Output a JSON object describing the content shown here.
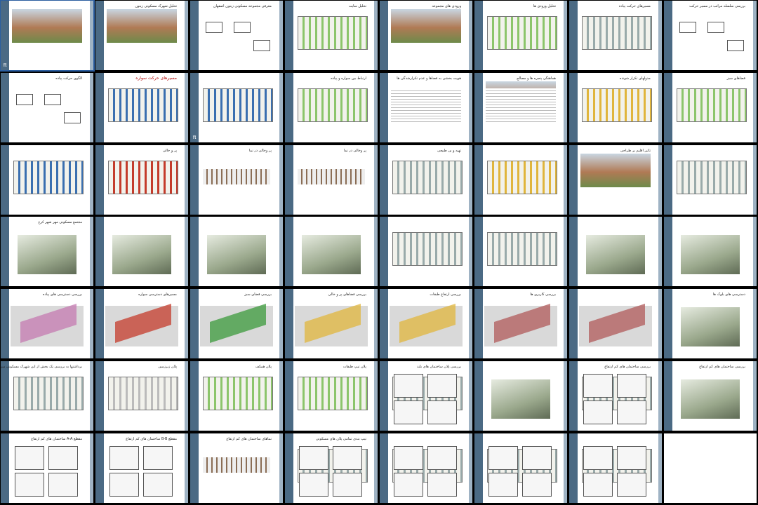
{
  "app": {
    "view": "slide-sorter",
    "page_label": "π"
  },
  "slides": [
    {
      "title": ""
    },
    {
      "title": "تحلیل شهرک مسکونی زیتون"
    },
    {
      "title": "معرفی مجموعه مسکونی زیتون اصفهان"
    },
    {
      "title": "تحلیل سایت"
    },
    {
      "title": "ورودی های مجموعه"
    },
    {
      "title": "تحلیل ورودی ها"
    },
    {
      "title": "مسیرهای حرکت پیاده"
    },
    {
      "title": "بررسی سلسله مراتب در مسیر حرکت"
    },
    {
      "title": "الگوی حرکت پیاده"
    },
    {
      "title": "مسیرهای حرکت سواره"
    },
    {
      "title": ""
    },
    {
      "title": "ارتباط بین سواره و پیاده"
    },
    {
      "title": "هویت بخشی به فضاها و عدم تکرارشدگی ها"
    },
    {
      "title": "هماهنگی پنجره ها و مصالح"
    },
    {
      "title": "مدولهای تکرار شونده"
    },
    {
      "title": "فضاهای سبز"
    },
    {
      "title": ""
    },
    {
      "title": "پر و خالی"
    },
    {
      "title": "پر وخالی در نما"
    },
    {
      "title": "پر وخالی در نما"
    },
    {
      "title": "تهیه و بن طبیعی"
    },
    {
      "title": ""
    },
    {
      "title": "تاثیر اقلیم بر طراحی"
    },
    {
      "title": ""
    },
    {
      "title": "مجتمع مسکونی مهر شهر کرج"
    },
    {
      "title": ""
    },
    {
      "title": ""
    },
    {
      "title": ""
    },
    {
      "title": ""
    },
    {
      "title": ""
    },
    {
      "title": ""
    },
    {
      "title": ""
    },
    {
      "title": "بررسی دسترسی های پیاده"
    },
    {
      "title": "مسیرهای دسترسی سواره"
    },
    {
      "title": "بررسی فضای سبز"
    },
    {
      "title": "بررسی فضاهای پر و خالی"
    },
    {
      "title": "بررسی ارتفاع طبقات"
    },
    {
      "title": "بررسی کاربری ها"
    },
    {
      "title": ""
    },
    {
      "title": "دسترسی های بلوک ها"
    },
    {
      "title": "برداشتها به بررسی یک بخش از این شهرک مسکونی میپردازیم"
    },
    {
      "title": "پلان زیرزمین"
    },
    {
      "title": "پلان همکف"
    },
    {
      "title": "پلان تیپ طبقات"
    },
    {
      "title": "بررسی پلان ساختمان های بلند"
    },
    {
      "title": ""
    },
    {
      "title": "بررسی ساختمان های کم ارتفاع"
    },
    {
      "title": "بررسی ساختمان های کم ارتفاع"
    },
    {
      "title": "مقطع A-A ساختمان های کم ارتفاع"
    },
    {
      "title": "مقطع B-B ساختمان های کم ارتفاع"
    },
    {
      "title": "نماهای ساختمان های کم ارتفاع"
    },
    {
      "title": "تیپ بندی تمامی پلان های مسکونی"
    },
    {
      "title": ""
    },
    {
      "title": ""
    },
    {
      "title": ""
    },
    {
      "title": ""
    }
  ],
  "colors": {
    "bar": "#4b6a84",
    "accent_red": "#b00000",
    "plan_green": "#8cc56b",
    "plan_blue": "#3a6fb0",
    "plan_yellow": "#e0b53c",
    "plan_red": "#c43b2b"
  }
}
